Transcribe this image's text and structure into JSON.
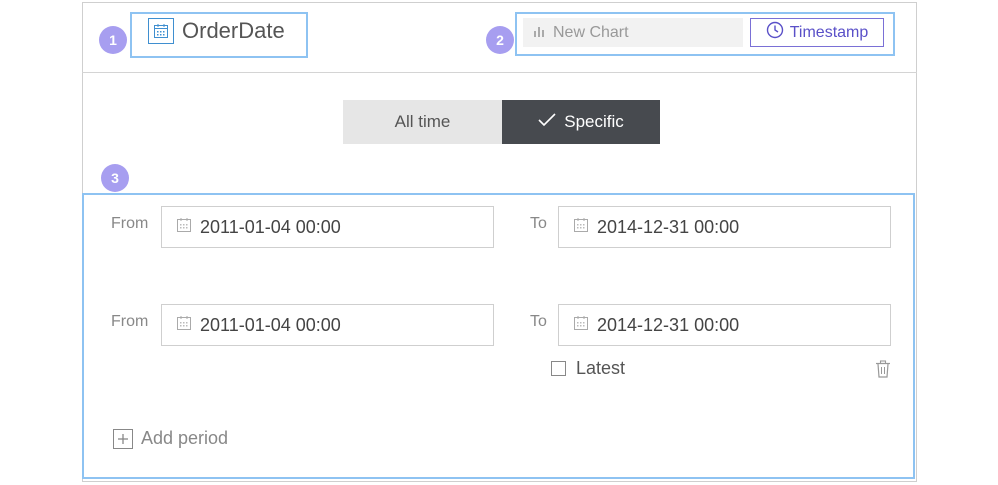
{
  "header": {
    "title": "OrderDate",
    "chart_placeholder": "New Chart",
    "timestamp_label": "Timestamp",
    "title_icon": "calendar-icon",
    "chart_icon": "bar-chart-icon",
    "timestamp_icon": "clock-icon"
  },
  "badges": [
    "1",
    "2",
    "3"
  ],
  "toggle": {
    "all_time": "All time",
    "specific": "Specific",
    "selected": "Specific"
  },
  "periods": [
    {
      "from_label": "From",
      "from_value": "2011-01-04 00:00",
      "to_label": "To",
      "to_value": "2014-12-31 00:00"
    },
    {
      "from_label": "From",
      "from_value": "2011-01-04 00:00",
      "to_label": "To",
      "to_value": "2014-12-31 00:00"
    }
  ],
  "latest_label": "Latest",
  "latest_checked": false,
  "add_period_label": "Add period",
  "colors": {
    "badge": "#a79ef0",
    "highlight": "#8ec3f2",
    "accent": "#5a50c8",
    "selected_toggle": "#474a4f"
  }
}
